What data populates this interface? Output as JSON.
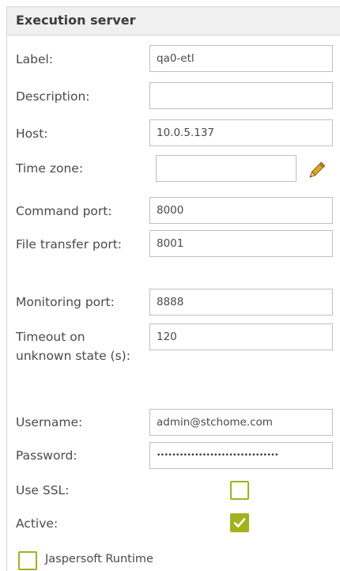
{
  "header": {
    "title": "Execution server"
  },
  "fields": {
    "label": {
      "label": "Label:",
      "value": "qa0-etl"
    },
    "description": {
      "label": "Description:",
      "value": ""
    },
    "host": {
      "label": "Host:",
      "value": "10.0.5.137"
    },
    "timezone": {
      "label": "Time zone:",
      "value": "",
      "icon": "pencil-icon"
    },
    "command_port": {
      "label": "Command port:",
      "value": "8000"
    },
    "file_transfer_port": {
      "label": "File transfer port:",
      "value": "8001"
    },
    "monitoring_port": {
      "label": "Monitoring port:",
      "value": "8888"
    },
    "timeout": {
      "label": "Timeout on unknown state (s):",
      "value": "120"
    },
    "username": {
      "label": "Username:",
      "value": "admin@stchome.com"
    },
    "password": {
      "label": "Password:",
      "value": "••••••••••••••••••••••••••••••••"
    }
  },
  "options": {
    "use_ssl": {
      "label": "Use SSL:",
      "checked": false
    },
    "active": {
      "label": "Active:",
      "checked": true
    },
    "jaspersoft_runtime": {
      "label": "Jaspersoft Runtime",
      "checked": false
    }
  },
  "colors": {
    "accent": "#a2b21c",
    "pencil": "#e0a526",
    "header_bg": "#f0f0f0"
  }
}
